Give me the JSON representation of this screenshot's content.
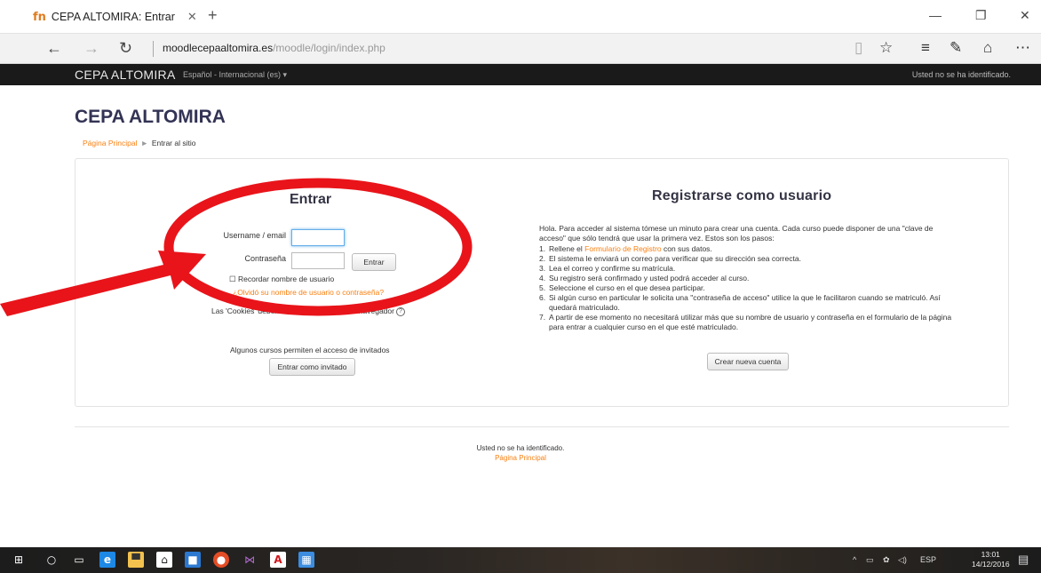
{
  "browser": {
    "tab_title": "CEPA ALTOMIRA: Entrar",
    "favicon": "fn",
    "url_host": "moodlecepaaltomira.es",
    "url_path": "/moodle/login/index.php"
  },
  "navbar": {
    "brand": "CEPA ALTOMIRA",
    "language": "Español - Internacional (es) ▾",
    "status": "Usted no se ha identificado."
  },
  "page": {
    "site_title": "CEPA ALTOMIRA",
    "breadcrumb": {
      "home": "Página Principal",
      "separator": "►",
      "current": "Entrar al sitio"
    }
  },
  "login": {
    "heading": "Entrar",
    "username_label": "Username / email",
    "username_value": "",
    "password_label": "Contraseña",
    "password_value": "",
    "submit": "Entrar",
    "remember": "Recordar nombre de usuario",
    "forgot": "¿Olvidó su nombre de usuario o contraseña?",
    "cookies": "Las 'Cookies' deben estar habilitadas en su navegador",
    "guest_note": "Algunos cursos permiten el acceso de invitados",
    "guest_button": "Entrar como invitado"
  },
  "signup": {
    "heading": "Registrarse como usuario",
    "intro": "Hola. Para acceder al sistema tómese un minuto para crear una cuenta. Cada curso puede disponer de una \"clave de acceso\" que sólo tendrá que usar la primera vez. Estos son los pasos:",
    "step1_pre": "Rellene el ",
    "step1_link": "Formulario de Registro",
    "step1_post": " con sus datos.",
    "steps": [
      "El sistema le enviará un correo para verificar que su dirección sea correcta.",
      "Lea el correo y confirme su matrícula.",
      "Su registro será confirmado y usted podrá acceder al curso.",
      "Seleccione el curso en el que desea participar.",
      "Si algún curso en particular le solicita una \"contraseña de acceso\" utilice la que le facilitaron cuando se matriculó. Así quedará matriculado.",
      "A partir de ese momento no necesitará utilizar más que su nombre de usuario y contraseña en el formulario de la página para entrar a cualquier curso en el que esté matriculado."
    ],
    "button": "Crear nueva cuenta"
  },
  "footer": {
    "status": "Usted no se ha identificado.",
    "home_link": "Página Principal"
  },
  "taskbar": {
    "language": "ESP",
    "time": "13:01",
    "date": "14/12/2016"
  },
  "colors": {
    "annotation_red": "#e8141a",
    "moodle_orange": "#f98012",
    "navbar_dark": "#1a1a1a"
  }
}
